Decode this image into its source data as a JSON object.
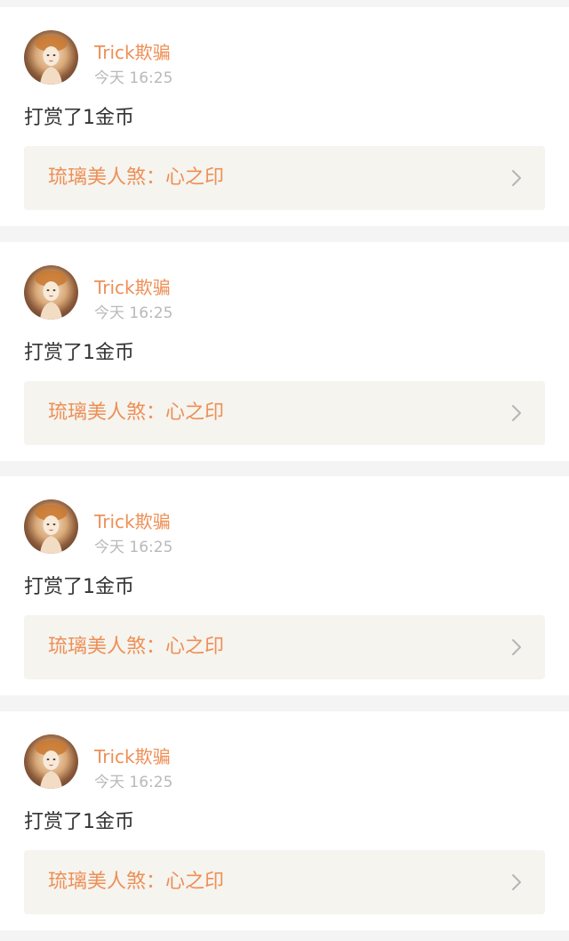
{
  "feed": {
    "items": [
      {
        "username": "Trick欺骗",
        "time": "今天 16:25",
        "message": "打赏了1金币",
        "book_title": "琉璃美人煞：心之印",
        "avatar_icon": "avatar-illustrated-girl",
        "chevron_icon": "chevron-right-icon"
      },
      {
        "username": "Trick欺骗",
        "time": "今天 16:25",
        "message": "打赏了1金币",
        "book_title": "琉璃美人煞：心之印",
        "avatar_icon": "avatar-illustrated-girl",
        "chevron_icon": "chevron-right-icon"
      },
      {
        "username": "Trick欺骗",
        "time": "今天 16:25",
        "message": "打赏了1金币",
        "book_title": "琉璃美人煞：心之印",
        "avatar_icon": "avatar-illustrated-girl",
        "chevron_icon": "chevron-right-icon"
      },
      {
        "username": "Trick欺骗",
        "time": "今天 16:25",
        "message": "打赏了1金币",
        "book_title": "琉璃美人煞：心之印",
        "avatar_icon": "avatar-illustrated-girl",
        "chevron_icon": "chevron-right-icon"
      }
    ]
  },
  "colors": {
    "accent": "#ee8f56",
    "page_background": "#f4f4f4",
    "card_background": "#ffffff",
    "link_background": "#f5f4ef",
    "timestamp": "#b9b9b9",
    "text": "#333333"
  }
}
